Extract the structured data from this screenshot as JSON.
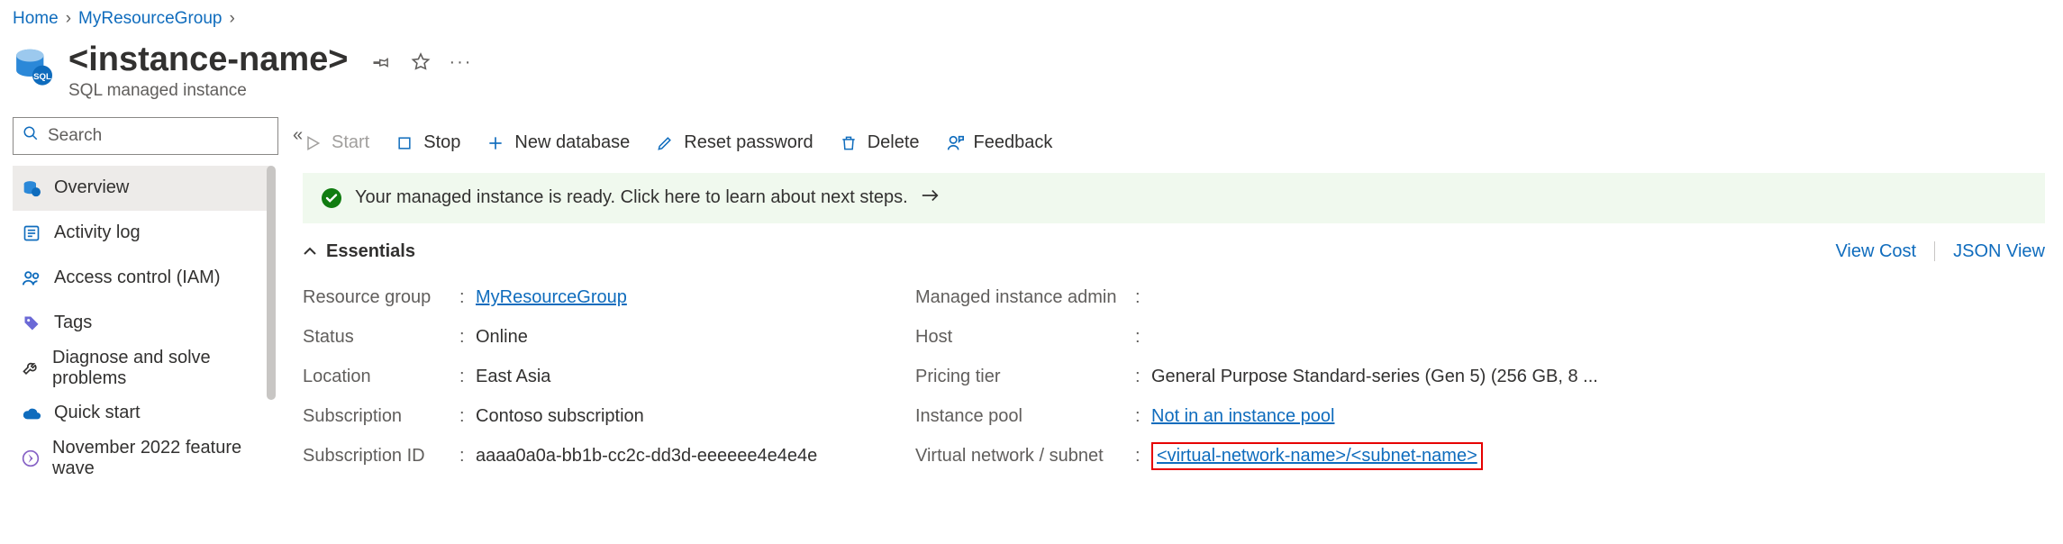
{
  "breadcrumb": {
    "home": "Home",
    "group": "MyResourceGroup"
  },
  "header": {
    "title": "<instance-name>",
    "subtitle": "SQL managed instance"
  },
  "search": {
    "placeholder": "Search"
  },
  "sidebar": {
    "items": [
      {
        "label": "Overview"
      },
      {
        "label": "Activity log"
      },
      {
        "label": "Access control (IAM)"
      },
      {
        "label": "Tags"
      },
      {
        "label": "Diagnose and solve problems"
      },
      {
        "label": "Quick start"
      },
      {
        "label": "November 2022 feature wave"
      }
    ]
  },
  "toolbar": {
    "start": "Start",
    "stop": "Stop",
    "newdb": "New database",
    "reset": "Reset password",
    "delete": "Delete",
    "feedback": "Feedback"
  },
  "notification": {
    "text": "Your managed instance is ready. Click here to learn about next steps."
  },
  "essentials": {
    "heading": "Essentials",
    "view_cost": "View Cost",
    "json_view": "JSON View",
    "left": {
      "resource_group_label": "Resource group",
      "resource_group_value": "MyResourceGroup",
      "status_label": "Status",
      "status_value": "Online",
      "location_label": "Location",
      "location_value": "East Asia",
      "subscription_label": "Subscription",
      "subscription_value": "Contoso subscription",
      "subscription_id_label": "Subscription ID",
      "subscription_id_value": "aaaa0a0a-bb1b-cc2c-dd3d-eeeeee4e4e4e"
    },
    "right": {
      "admin_label": "Managed instance admin",
      "admin_value": "",
      "host_label": "Host",
      "host_value": "",
      "pricing_label": "Pricing tier",
      "pricing_value": "General Purpose Standard-series (Gen 5) (256 GB, 8 ...",
      "pool_label": "Instance pool",
      "pool_value": "Not in an instance pool",
      "vnet_label": "Virtual network / subnet",
      "vnet_value": "<virtual-network-name>/<subnet-name>"
    }
  }
}
